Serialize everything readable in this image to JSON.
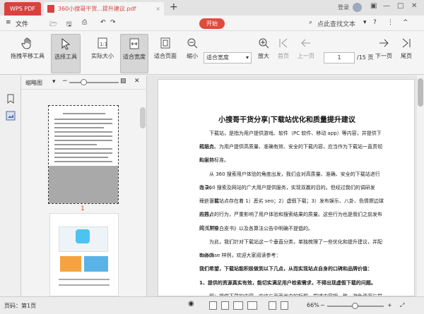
{
  "titlebar": {
    "app_tab": "WPS PDF",
    "doc_tab": "360小搜哥干货...提升建议.pdf",
    "login": "登录"
  },
  "menubar": {
    "file": "文件",
    "start": "开始",
    "search_placeholder": "点此查找文本"
  },
  "toolbar": {
    "pan": "拖拽平移工具",
    "select": "选择工具",
    "actual_size": "实际大小",
    "fit_width": "适合宽度",
    "fit_page": "适合页面",
    "zoom_out": "缩小",
    "zoom_mode": "适合宽度",
    "zoom_in": "放大",
    "first_page": "首页",
    "prev_page": "上一页",
    "current_page": "1",
    "total_pages": "/15 页",
    "next_page": "下一页",
    "last_page": "尾页"
  },
  "thumbnails": {
    "title": "缩略图",
    "page1_number": "1"
  },
  "document": {
    "title": "小搜哥干货分享|下载站优化和质量提升建议",
    "paragraphs": [
      "下载站，是指为用户提供游戏、软件（PC 软件、移动 app）等内容，并提供下载服务",
      "的站点。为用户提供高质量、准确有效、安全的下载内容，应当作为下载站一直贯彻和坚持",
      "的服务标准。",
      "从 360 搜索用户体验的角度出发，我们会对高质量、准确、安全的下载站进行收录，",
      "为 360 搜索及网站的广大用户提供服务，实现双赢的目的。但经过我们的调研发现，目前",
      "一些下载站点存在着 1）恶劣 seo；2）虚假下载；3）发布娱乐、八卦、色情擦边球内容，",
      "题热点的行为，严重影响了用户体验和搜索结果的质量。这些行为也是我们之前发布的《360",
      "网页质量白皮书》以及各算法公告中明确不提倡的。",
      "为此，我们针对下载站这一个垂直分类，单独梳理了一些优化和提升建议，并配有各类",
      "badcase 样例，欢迎大家阅读参考：",
      "我们希望，下载站能积极做到以下几点，从而实现站点自身的口碑和品牌价值：",
      "1、提供的资源真实有效，能切实满足用户检索需求，不得出现虚假下载的问题。",
      "即：提供下载的内容，应该与页面当中的标题、描述内容相一致，避免资源与描述页面"
    ]
  },
  "statusbar": {
    "page_label": "页码：第1页",
    "zoom": "66%"
  },
  "colors": {
    "accent": "#d9413f",
    "start_button": "#e04b3a"
  }
}
